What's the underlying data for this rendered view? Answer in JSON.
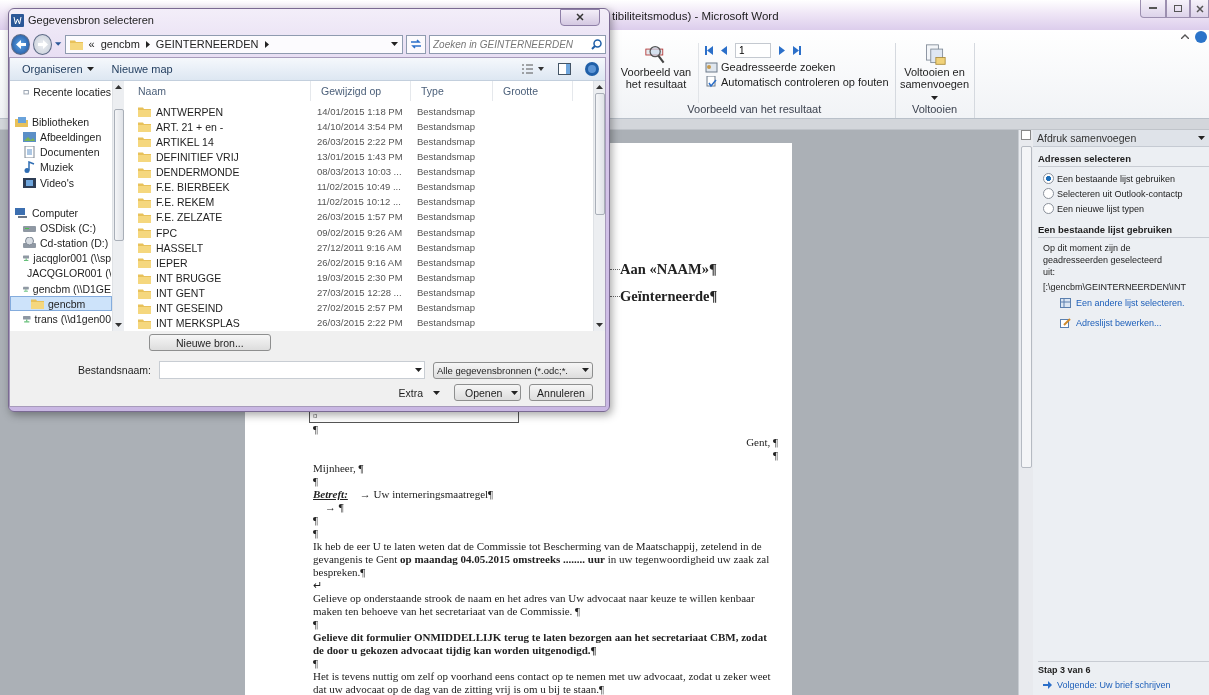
{
  "word": {
    "title": "tibiliteitsmodus) - Microsoft Word",
    "ribbon": {
      "preview_button": "Voorbeeld van het resultaat",
      "record_field": "1",
      "find_recipient": "Geadresseerde zoeken",
      "check_errors": "Automatisch controleren op fouten",
      "preview_group": "Voorbeeld van het resultaat",
      "finish_button": "Voltooien en samenvoegen",
      "finish_group": "Voltooien"
    },
    "document": [
      {
        "kind": "field",
        "text": "Aan «NAAM»¶"
      },
      {
        "kind": "field",
        "text": "Geïnterneerde¶"
      },
      {
        "kind": "table",
        "text": "¤"
      },
      {
        "kind": "mark",
        "text": "¶"
      },
      {
        "kind": "right",
        "text": "Gent, ¶"
      },
      {
        "kind": "right",
        "text": "¶"
      },
      {
        "kind": "text",
        "text": "Mijnheer, ¶"
      },
      {
        "kind": "mark",
        "text": "¶"
      },
      {
        "kind": "subject",
        "label": "Betreft:",
        "text": "→   Uw interneringsmaatregel¶"
      },
      {
        "kind": "tab",
        "text": "→   ¶"
      },
      {
        "kind": "mark",
        "text": "¶"
      },
      {
        "kind": "mark",
        "text": "¶"
      },
      {
        "kind": "text",
        "text": "Ik heb de eer U te laten weten dat de Commissie tot Bescherming van de Maatschappij, zetelend in de gevangenis te Gent **op maandag 04.05.2015 omstreeks ........ uur** in uw tegenwoordigheid uw zaak zal bespreken.¶"
      },
      {
        "kind": "mark",
        "text": "↵"
      },
      {
        "kind": "text",
        "text": "Gelieve op onderstaande strook de naam en het adres van Uw advocaat naar keuze te willen kenbaar maken ten behoeve van het secretariaat van de Commissie. ¶"
      },
      {
        "kind": "mark",
        "text": "¶"
      },
      {
        "kind": "bold",
        "text": "Gelieve dit formulier ONMIDDELLIJK terug te laten bezorgen aan het secretariaat CBM, zodat de door u gekozen advocaat tijdig kan worden uitgenodigd.¶"
      },
      {
        "kind": "mark",
        "text": "¶"
      },
      {
        "kind": "text",
        "text": "Het is tevens nuttig om zelf op voorhand eens contact op te nemen met uw advocaat, zodat u zeker weet dat uw advocaat op de dag van de zitting vrij is om u bij te staan.¶"
      }
    ],
    "task_pane": {
      "title": "Afdruk samenvoegen",
      "section": "Adressen selecteren",
      "options": [
        {
          "label": "Een bestaande lijst gebruiken",
          "selected": true
        },
        {
          "label": "Selecteren uit Outlook-contactp",
          "selected": false
        },
        {
          "label": "Een nieuwe lijst typen",
          "selected": false
        }
      ],
      "subsection": "Een bestaande lijst gebruiken",
      "info": "Op dit moment zijn de geadresseerden geselecteerd uit:",
      "path": "[:\\gencbm\\GEINTERNEERDEN\\INT",
      "links": [
        "Een andere lijst selecteren.",
        "Adreslijst bewerken..."
      ],
      "step": "Stap 3 van 6",
      "next": "Volgende: Uw brief schrijven"
    }
  },
  "dialog": {
    "title": "Gegevensbron selecteren",
    "breadcrumb": [
      "«",
      "gencbm",
      "GEINTERNEERDEN"
    ],
    "search_placeholder": "Zoeken in GEINTERNEERDEN",
    "toolbar": [
      "Organiseren",
      "Nieuwe map"
    ],
    "nav": [
      {
        "label": "Recente locaties",
        "kind": "recent",
        "selected": false
      },
      {
        "label": "Bibliotheken",
        "kind": "library",
        "selected": false,
        "children": [
          {
            "label": "Afbeeldingen",
            "kind": "pictures",
            "selected": false
          },
          {
            "label": "Documenten",
            "kind": "documents",
            "selected": false
          },
          {
            "label": "Muziek",
            "kind": "music",
            "selected": false
          },
          {
            "label": "Video's",
            "kind": "video",
            "selected": false
          }
        ]
      },
      {
        "label": "Computer",
        "kind": "computer",
        "selected": false,
        "children": [
          {
            "label": "OSDisk (C:)",
            "kind": "disk",
            "selected": false
          },
          {
            "label": "Cd-station (D:)",
            "kind": "cdrom",
            "selected": false
          },
          {
            "label": "jacqglor001 (\\\\sp",
            "kind": "network",
            "selected": false
          },
          {
            "label": "JACQGLOR001 (\\",
            "kind": "network",
            "selected": false
          },
          {
            "label": "gencbm (\\\\D1GE",
            "kind": "network",
            "selected": false,
            "children": [
              {
                "label": "gencbm",
                "kind": "folder",
                "selected": true
              }
            ]
          },
          {
            "label": "trans (\\\\d1gen00",
            "kind": "network",
            "selected": false
          }
        ]
      }
    ],
    "columns": [
      "Naam",
      "Gewijzigd op",
      "Type",
      "Grootte"
    ],
    "rows": [
      {
        "name": "ANTWERPEN",
        "modified": "14/01/2015 1:18 PM",
        "type": "Bestandsmap"
      },
      {
        "name": "ART. 21 + en -",
        "modified": "14/10/2014 3:54 PM",
        "type": "Bestandsmap"
      },
      {
        "name": "ARTIKEL 14",
        "modified": "26/03/2015 2:22 PM",
        "type": "Bestandsmap"
      },
      {
        "name": "DEFINITIEF VRIJ",
        "modified": "13/01/2015 1:43 PM",
        "type": "Bestandsmap"
      },
      {
        "name": "DENDERMONDE",
        "modified": "08/03/2013 10:03 ...",
        "type": "Bestandsmap"
      },
      {
        "name": "F.E. BIERBEEK",
        "modified": "11/02/2015 10:49 ...",
        "type": "Bestandsmap"
      },
      {
        "name": "F.E. REKEM",
        "modified": "11/02/2015 10:12 ...",
        "type": "Bestandsmap"
      },
      {
        "name": "F.E. ZELZATE",
        "modified": "26/03/2015 1:57 PM",
        "type": "Bestandsmap"
      },
      {
        "name": "FPC",
        "modified": "09/02/2015 9:26 AM",
        "type": "Bestandsmap"
      },
      {
        "name": "HASSELT",
        "modified": "27/12/2011 9:16 AM",
        "type": "Bestandsmap"
      },
      {
        "name": "IEPER",
        "modified": "26/02/2015 9:16 AM",
        "type": "Bestandsmap"
      },
      {
        "name": "INT BRUGGE",
        "modified": "19/03/2015 2:30 PM",
        "type": "Bestandsmap"
      },
      {
        "name": "INT GENT",
        "modified": "27/03/2015 12:28 ...",
        "type": "Bestandsmap"
      },
      {
        "name": "INT GESEIND",
        "modified": "27/02/2015 2:57 PM",
        "type": "Bestandsmap"
      },
      {
        "name": "INT MERKSPLAS",
        "modified": "26/03/2015 2:22 PM",
        "type": "Bestandsmap"
      }
    ],
    "new_source_button": "Nieuwe bron...",
    "filename_label": "Bestandsnaam:",
    "filter": "Alle gegevensbronnen (*.odc;*.",
    "extra": "Extra",
    "open_button": "Openen",
    "cancel_button": "Annuleren"
  }
}
